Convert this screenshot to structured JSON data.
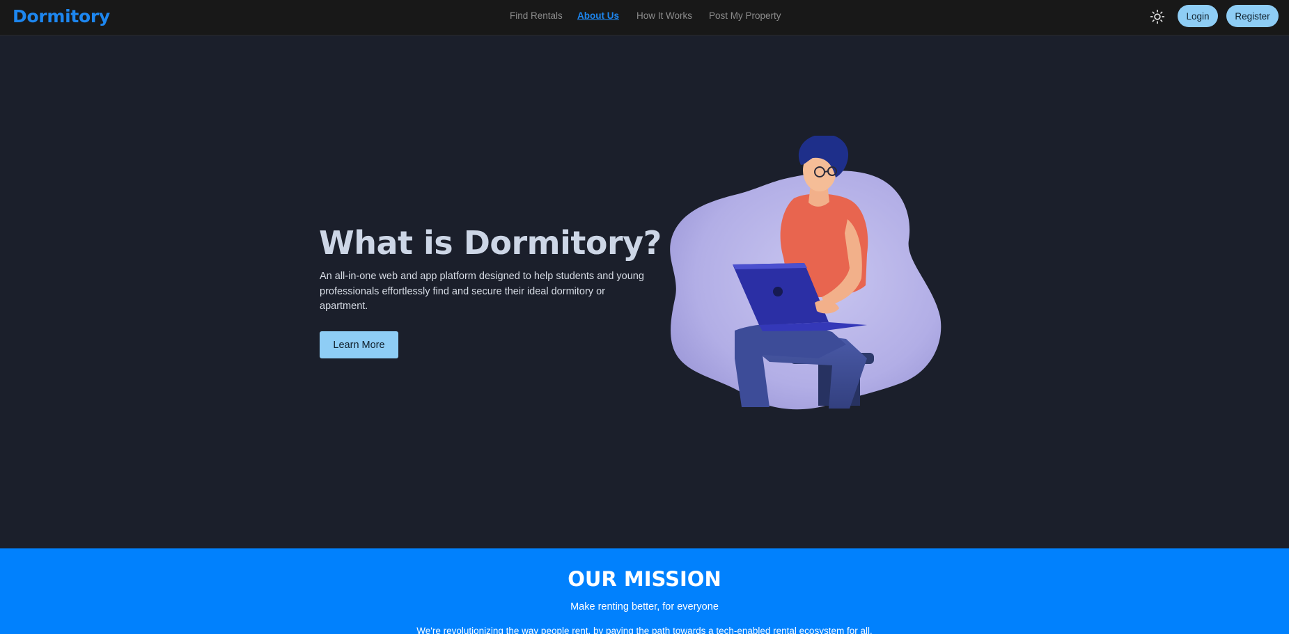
{
  "navbar": {
    "brand": "Dormitory",
    "links": [
      {
        "label": "Find Rentals",
        "active": false
      },
      {
        "label": "About Us",
        "active": true
      },
      {
        "label": "How It Works",
        "active": false
      },
      {
        "label": "Post My Property",
        "active": false
      }
    ],
    "theme_icon": "sun-icon",
    "login_label": "Login",
    "register_label": "Register"
  },
  "hero": {
    "title": "What is Dormitory?",
    "description": "An all-in-one web and app platform designed to help students and young professionals effortlessly find and secure their ideal dormitory or apartment.",
    "button_label": "Learn More",
    "illustration": "person-with-laptop-illustration"
  },
  "mission": {
    "title": "OUR MISSION",
    "subtitle": "Make renting better, for everyone",
    "body": "We're revolutionizing the way people rent, by paving the path towards a tech-enabled rental ecosystem for all."
  },
  "colors": {
    "page_bg": "#1b1f2b",
    "navbar_bg": "#181818",
    "accent": "#1d86ef",
    "button_bg": "#8ecdf5",
    "mission_bg": "#0181fd"
  }
}
